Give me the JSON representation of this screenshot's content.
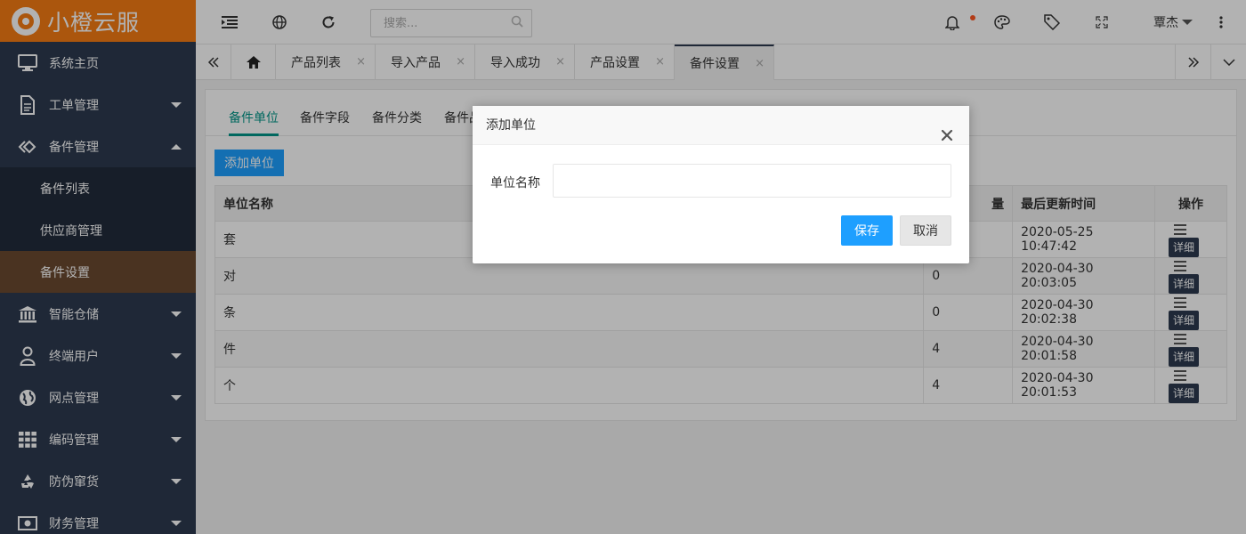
{
  "sidebar": {
    "logo_text": "小橙云服",
    "items": [
      {
        "label": "系统主页",
        "icon": "monitor-icon"
      },
      {
        "label": "工单管理",
        "icon": "document-icon"
      },
      {
        "label": "备件管理",
        "icon": "diamond-icon"
      },
      {
        "label": "智能仓储",
        "icon": "bank-icon"
      },
      {
        "label": "终端用户",
        "icon": "user-icon"
      },
      {
        "label": "网点管理",
        "icon": "globe-icon"
      },
      {
        "label": "编码管理",
        "icon": "grid-icon"
      },
      {
        "label": "防伪窜货",
        "icon": "recycle-icon"
      },
      {
        "label": "财务管理",
        "icon": "money-icon"
      }
    ],
    "subitems": [
      {
        "label": "备件列表"
      },
      {
        "label": "供应商管理"
      },
      {
        "label": "备件设置",
        "active": true
      }
    ]
  },
  "header": {
    "search_placeholder": "搜索...",
    "user_name": "覃杰",
    "accent_color": "#f57c13"
  },
  "tabs": {
    "items": [
      {
        "label": "产品列表"
      },
      {
        "label": "导入产品"
      },
      {
        "label": "导入成功"
      },
      {
        "label": "产品设置"
      },
      {
        "label": "备件设置",
        "active": true
      }
    ],
    "close_symbol": "×"
  },
  "content": {
    "subtabs": [
      "备件单位",
      "备件字段",
      "备件分类",
      "备件品"
    ],
    "add_button": "添加单位",
    "table": {
      "headers": [
        "单位名称",
        "量",
        "最后更新时间",
        "操作"
      ],
      "rows": [
        {
          "name": "套",
          "count": "",
          "updated": "2020-05-25 10:47:42"
        },
        {
          "name": "对",
          "count": "0",
          "updated": "2020-04-30 20:03:05"
        },
        {
          "name": "条",
          "count": "0",
          "updated": "2020-04-30 20:02:38"
        },
        {
          "name": "件",
          "count": "4",
          "updated": "2020-04-30 20:01:58"
        },
        {
          "name": "个",
          "count": "4",
          "updated": "2020-04-30 20:01:53"
        }
      ],
      "detail_label": "详细"
    }
  },
  "modal": {
    "title": "添加单位",
    "field_label": "单位名称",
    "field_value": "",
    "save_label": "保存",
    "cancel_label": "取消"
  }
}
